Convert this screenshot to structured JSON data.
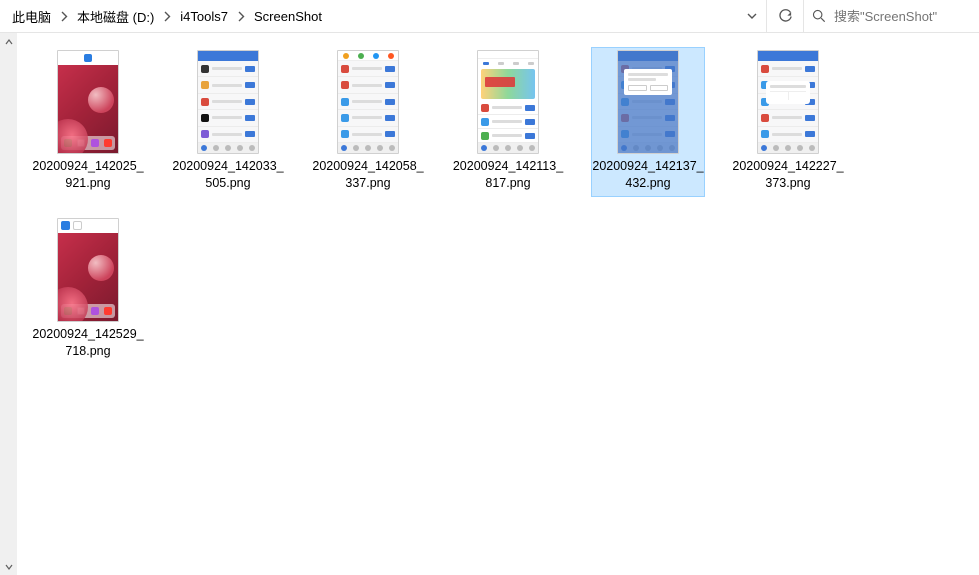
{
  "breadcrumb": {
    "items": [
      "此电脑",
      "本地磁盘 (D:)",
      "i4Tools7",
      "ScreenShot"
    ]
  },
  "search": {
    "placeholder": "搜索\"ScreenShot\""
  },
  "files": [
    {
      "name": "20200924_142025_921.png",
      "selected": false,
      "thumb": "wallpaper1"
    },
    {
      "name": "20200924_142033_505.png",
      "selected": false,
      "thumb": "list1"
    },
    {
      "name": "20200924_142058_337.png",
      "selected": false,
      "thumb": "list2"
    },
    {
      "name": "20200924_142113_817.png",
      "selected": false,
      "thumb": "banner"
    },
    {
      "name": "20200924_142137_432.png",
      "selected": true,
      "thumb": "popup"
    },
    {
      "name": "20200924_142227_373.png",
      "selected": false,
      "thumb": "dialog"
    },
    {
      "name": "20200924_142529_718.png",
      "selected": false,
      "thumb": "wallpaper2"
    }
  ]
}
